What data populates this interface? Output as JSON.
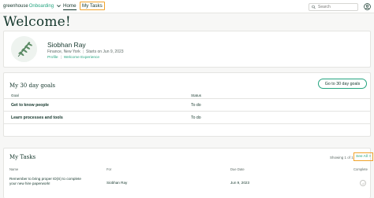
{
  "nav": {
    "brand_main": "greenhouse",
    "brand_sub": "Onboarding",
    "home_label": "Home",
    "tasks_label": "My Tasks",
    "search_placeholder": "Search"
  },
  "page": {
    "title": "Welcome!"
  },
  "profile": {
    "name": "Siobhan Ray",
    "department": "Finance, New York",
    "start": "Starts on Jun 9, 2023",
    "link_profile": "Profile",
    "link_experience": "Welcome Experience"
  },
  "goals": {
    "title": "My 30 day goals",
    "button_label": "Go to 30 day goals",
    "columns": [
      "Goal",
      "Status"
    ],
    "rows": [
      {
        "goal": "Get to know people",
        "status": "To do"
      },
      {
        "goal": "Learn processes and tools",
        "status": "To do"
      }
    ]
  },
  "tasks": {
    "title": "My Tasks",
    "showing": "Showing 1 of 1",
    "see_all": "See All >",
    "columns": [
      "Name",
      "For",
      "Due Date",
      "Complete"
    ],
    "rows": [
      {
        "name": "Remember to bring proper ID(S) to complete your new hire paperwork!",
        "for": "Siobhan Ray",
        "due": "Jun 9, 2023"
      }
    ]
  },
  "colors": {
    "accent": "#24a47f",
    "highlight": "#f0a32c",
    "text": "#15372c"
  }
}
